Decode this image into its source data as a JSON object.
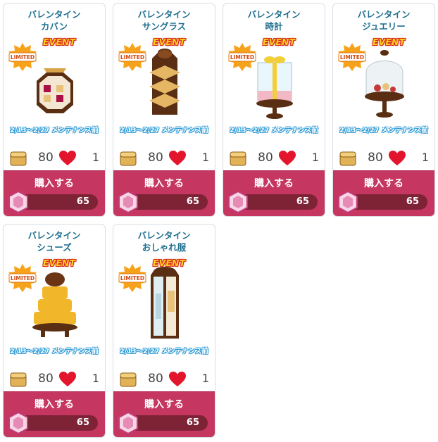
{
  "items": [
    {
      "title_line1": "バレンタイン",
      "title_line2": "カバン",
      "badge": "LIMITED",
      "event": "EVENT",
      "period": "2/13～2/27 メンテナンス前",
      "price": "80",
      "likes": "1",
      "buy_label": "購入する",
      "cost": "65",
      "art": "bag-icon"
    },
    {
      "title_line1": "バレンタイン",
      "title_line2": "サングラス",
      "badge": "LIMITED",
      "event": "EVENT",
      "period": "2/13～2/27 メンテナンス前",
      "price": "80",
      "likes": "1",
      "buy_label": "購入する",
      "cost": "65",
      "art": "sunglasses-display-icon"
    },
    {
      "title_line1": "バレンタイン",
      "title_line2": "時計",
      "badge": "LIMITED",
      "event": "EVENT",
      "period": "2/13～2/27 メンテナンス前",
      "price": "80",
      "likes": "1",
      "buy_label": "購入する",
      "cost": "65",
      "art": "watch-case-icon"
    },
    {
      "title_line1": "バレンタイン",
      "title_line2": "ジュエリー",
      "badge": "LIMITED",
      "event": "EVENT",
      "period": "2/13～2/27 メンテナンス前",
      "price": "80",
      "likes": "1",
      "buy_label": "購入する",
      "cost": "65",
      "art": "jewelry-dome-icon"
    },
    {
      "title_line1": "バレンタイン",
      "title_line2": "シューズ",
      "badge": "LIMITED",
      "event": "EVENT",
      "period": "2/13～2/27 メンテナンス前",
      "price": "80",
      "likes": "1",
      "buy_label": "購入する",
      "cost": "65",
      "art": "shoes-tower-icon"
    },
    {
      "title_line1": "バレンタイン",
      "title_line2": "おしゃれ服",
      "badge": "LIMITED",
      "event": "EVENT",
      "period": "2/13～2/27 メンテナンス前",
      "price": "80",
      "likes": "1",
      "buy_label": "購入する",
      "cost": "65",
      "art": "wardrobe-icon"
    }
  ],
  "colors": {
    "accent": "#c53760",
    "cost_bar": "#7e2336",
    "title": "#1f6f8f",
    "period_outline": "#2b9ad6"
  }
}
